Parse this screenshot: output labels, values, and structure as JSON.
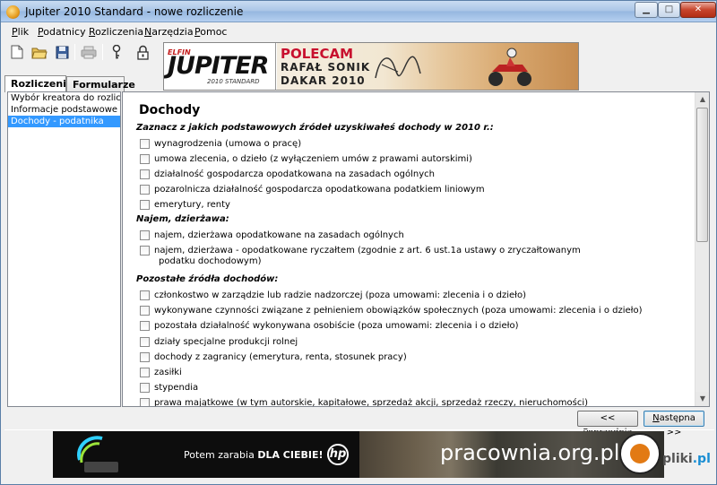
{
  "window": {
    "title": "Jupiter 2010 Standard - nowe rozliczenie"
  },
  "menu": [
    {
      "label": "Plik",
      "u": "P",
      "rest": "lik"
    },
    {
      "label": "Podatnicy",
      "u": "P",
      "rest": "odatnicy"
    },
    {
      "label": "Rozliczenia",
      "u": "R",
      "rest": "ozliczenia"
    },
    {
      "label": "Narzędzia",
      "u": "N",
      "rest": "arzędzia"
    },
    {
      "label": "Pomoc",
      "u": "P",
      "rest": "omoc"
    }
  ],
  "toolbar": {
    "icons": [
      "new-document-icon",
      "open-folder-icon",
      "save-icon",
      "print-icon",
      "key-icon",
      "lock-icon"
    ]
  },
  "banner_top": {
    "brand_small": "ELFIN",
    "brand": "JUPITER",
    "brand_sub": "2010 STANDARD",
    "promo_line1": "POLECAM",
    "promo_line2": "RAFAŁ SONIK",
    "promo_line3": "DAKAR 2010"
  },
  "tabs": [
    {
      "label": "Rozliczenie",
      "active": true
    },
    {
      "label": "Formularze",
      "active": false
    }
  ],
  "left_list": [
    {
      "label": "Wybór kreatora do rozliczenia",
      "selected": false
    },
    {
      "label": "Informacje podstawowe",
      "selected": false
    },
    {
      "label": "Dochody - podatnika",
      "selected": true
    }
  ],
  "main": {
    "title": "Dochody",
    "section1": {
      "heading": "Zaznacz z jakich podstawowych źródeł uzyskiwałeś dochody w 2010 r.:",
      "items": [
        "wynagrodzenia (umowa o pracę)",
        "umowa zlecenia, o dzieło (z wyłączeniem umów z prawami autorskimi)",
        "działalność gospodarcza opodatkowana na zasadach ogólnych",
        "pozarolnicza działalność gospodarcza opodatkowana podatkiem liniowym",
        "emerytury, renty"
      ]
    },
    "section2": {
      "heading": "Najem, dzierżawa:",
      "items": [
        "najem, dzierżawa opodatkowane na zasadach ogólnych",
        "najem, dzierżawa - opodatkowane ryczałtem (zgodnie z art. 6 ust.1a ustawy o zryczałtowanym"
      ],
      "item2_cont": "podatku dochodowym)"
    },
    "section3": {
      "heading": "Pozostałe źródła dochodów:",
      "items": [
        "członkostwo w zarządzie lub radzie nadzorczej (poza umowami: zlecenia i o dzieło)",
        "wykonywane czynności związane z pełnieniem obowiązków społecznych (poza umowami: zlecenia i o dzieło)",
        "pozostała działalność wykonywana osobiście (poza umowami: zlecenia i o dzieło)",
        "działy specjalne produkcji rolnej",
        "dochody z zagranicy (emerytura, renta, stosunek pracy)",
        "zasiłki",
        "stypendia",
        "prawa majątkowe (w tym autorskie, kapitałowe, sprzedaż akcji, sprzedaż rzeczy, nieruchomości)"
      ]
    }
  },
  "buttons": {
    "prev": "<< Poprzednia",
    "next_u": "N",
    "next_rest": "astępna >>"
  },
  "banner_bottom": {
    "hp_text_a": "Potem zarabia ",
    "hp_text_b": "DLA CIEBIE!",
    "hp_logo": "hp",
    "site": "pracownia.org.pl"
  },
  "footer_brand": {
    "a": "pliki",
    "b": ".pl"
  }
}
